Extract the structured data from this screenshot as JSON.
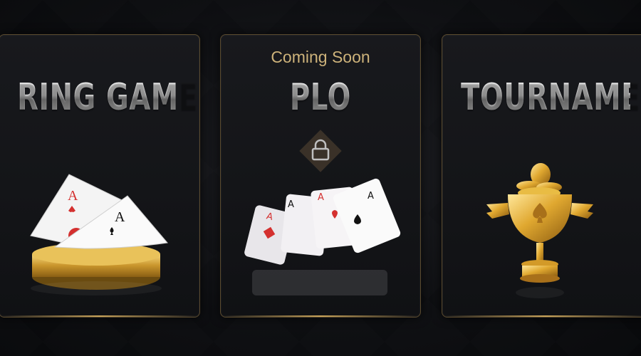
{
  "cards": {
    "ring": {
      "title": "RING GAME"
    },
    "plo": {
      "badge": "Coming Soon",
      "title": "PLO",
      "locked": true
    },
    "tournament": {
      "title": "TOURNAMENT"
    }
  },
  "colors": {
    "accent_gold": "#c9a45b",
    "badge_text": "#cdb27a",
    "card_red": "#d4302f"
  },
  "icons": [
    "lock-icon",
    "poker-cards-coin-icon",
    "fanned-cards-icon",
    "trophy-icon"
  ]
}
